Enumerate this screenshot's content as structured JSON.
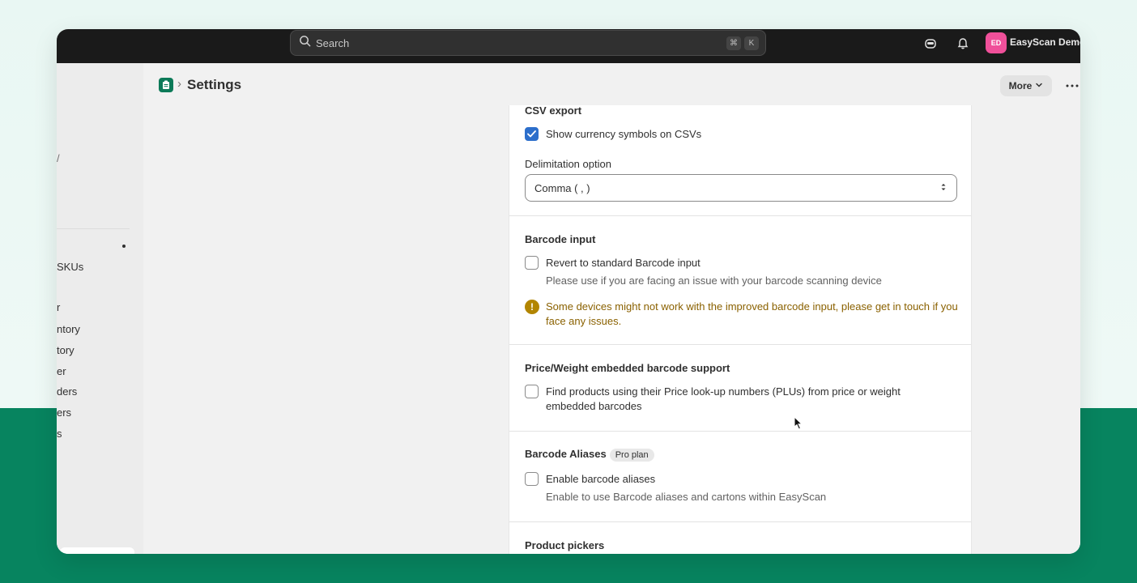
{
  "topbar": {
    "search_placeholder": "Search",
    "shortcut_keys": [
      "⌘",
      "K"
    ],
    "avatar_initials": "ED",
    "store_name": "EasyScan Demo",
    "avatar_color": "#f0509a"
  },
  "sidebar": {
    "items": [
      {
        "label": "/"
      },
      {
        "label": "SKUs"
      },
      {
        "label": "r"
      },
      {
        "label": "ntory"
      },
      {
        "label": "tory"
      },
      {
        "label": "er"
      },
      {
        "label": "ders"
      },
      {
        "label": "ers"
      },
      {
        "label": "s"
      }
    ]
  },
  "header": {
    "title": "Settings",
    "breadcrumb_sep": "›",
    "more_label": "More"
  },
  "sections": {
    "csv": {
      "title": "CSV export",
      "checkbox_label": "Show currency symbols on CSVs",
      "checkbox_checked": true,
      "delimitation_label": "Delimitation option",
      "delimitation_value": "Comma ( , )"
    },
    "barcode_input": {
      "title": "Barcode input",
      "checkbox_label": "Revert to standard Barcode input",
      "help": "Please use if you are facing an issue with your barcode scanning device",
      "warning": "Some devices might not work with the improved barcode input, please get in touch if you face any issues."
    },
    "price_weight": {
      "title": "Price/Weight embedded barcode support",
      "checkbox_label": "Find products using their Price look-up numbers (PLUs) from price or weight embedded barcodes"
    },
    "aliases": {
      "title": "Barcode Aliases",
      "badge": "Pro plan",
      "checkbox_label": "Enable barcode aliases",
      "help": "Enable to use Barcode aliases and cartons within EasyScan"
    },
    "pickers": {
      "title": "Product pickers"
    }
  },
  "colors": {
    "brand_green": "#07845f",
    "checkbox_blue": "#2c6ecb",
    "warning": "#b28500"
  }
}
